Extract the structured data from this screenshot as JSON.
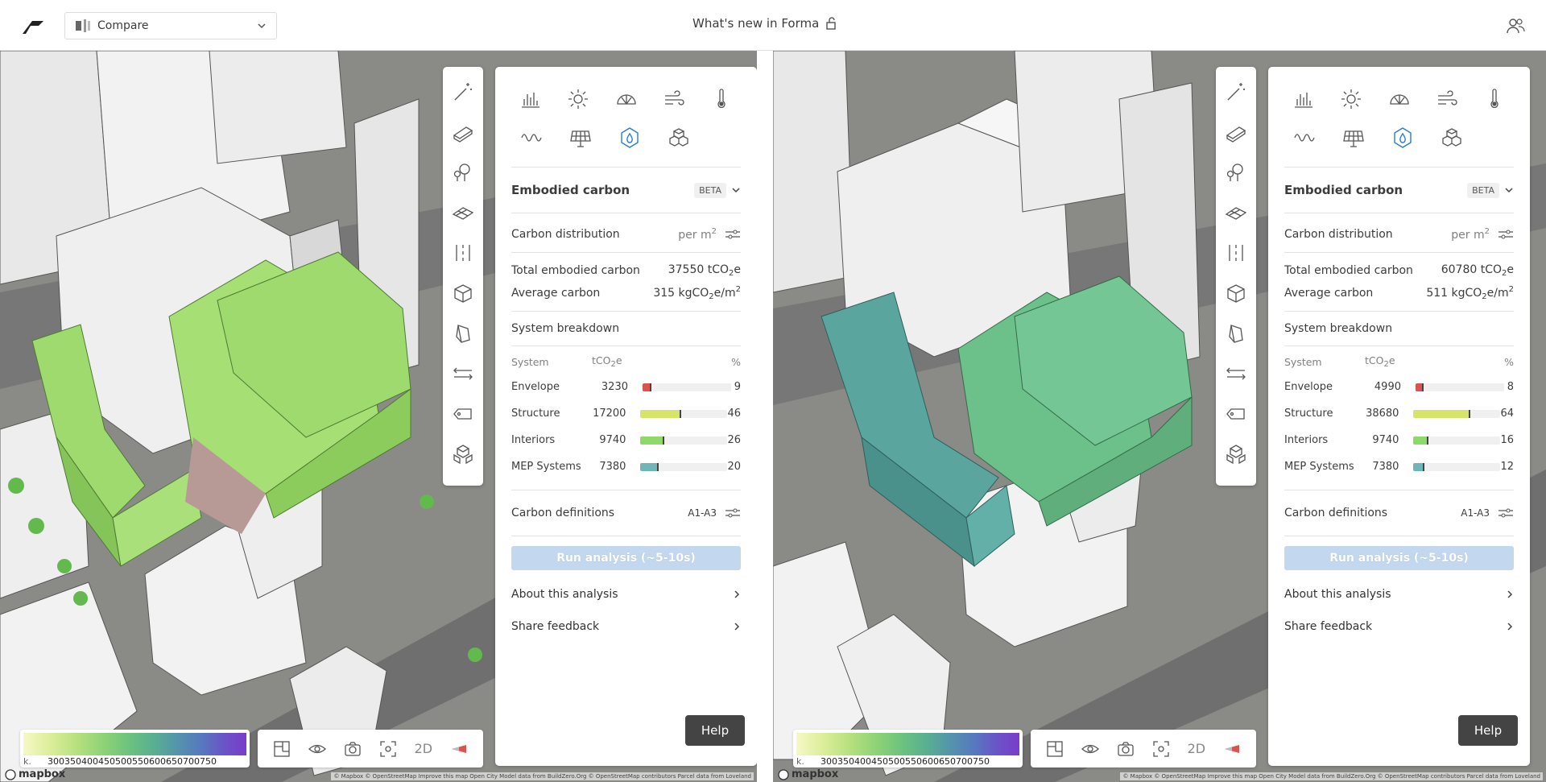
{
  "header": {
    "selector_label": "Compare",
    "title": "What's new in Forma"
  },
  "colors": {
    "left_buildings": "#9fda6e",
    "right_buildings_a": "#5aa69f",
    "right_buildings_b": "#6cc08a",
    "accent": "#2a7bd0",
    "run_button": "#c3d8ee"
  },
  "panes": [
    {
      "analysis_icons": [
        "bar-chart-icon",
        "sun-icon",
        "daylight-icon",
        "wind-icon",
        "thermometer-icon",
        "noise-icon",
        "solar-panel-icon",
        "carbon-drop-icon",
        "blocks-icon"
      ],
      "section_title": "Embodied carbon",
      "beta": "BETA",
      "carbon_distribution": "Carbon distribution",
      "per_m2": "per m",
      "total_label": "Total embodied carbon",
      "total_value": "37550 tCO",
      "total_unit": "e",
      "avg_label": "Average carbon",
      "avg_value": "315 kgCO",
      "avg_unit": "e/m",
      "system_breakdown": "System breakdown",
      "col_system": "System",
      "col_tco2e": "tCO",
      "col_pct": "%",
      "rows": [
        {
          "name": "Envelope",
          "value": "3230",
          "pct": "9",
          "frac": 0.09,
          "color": "#d9534f"
        },
        {
          "name": "Structure",
          "value": "17200",
          "pct": "46",
          "frac": 0.46,
          "color": "#d7e46a"
        },
        {
          "name": "Interiors",
          "value": "9740",
          "pct": "26",
          "frac": 0.26,
          "color": "#8fd96a"
        },
        {
          "name": "MEP Systems",
          "value": "7380",
          "pct": "20",
          "frac": 0.2,
          "color": "#6fb6b9"
        }
      ],
      "carbon_definitions": "Carbon definitions",
      "definitions_value": "A1-A3",
      "run_label": "Run analysis (~5-10s)",
      "about_label": "About this analysis",
      "feedback_label": "Share feedback",
      "help_label": "Help",
      "legend_ticks": [
        "k.",
        "300",
        "350",
        "400",
        "450",
        "500",
        "550",
        "600",
        "650",
        "700",
        "750"
      ],
      "view_2d": "2D"
    },
    {
      "analysis_icons": [
        "bar-chart-icon",
        "sun-icon",
        "daylight-icon",
        "wind-icon",
        "thermometer-icon",
        "noise-icon",
        "solar-panel-icon",
        "carbon-drop-icon",
        "blocks-icon"
      ],
      "section_title": "Embodied carbon",
      "beta": "BETA",
      "carbon_distribution": "Carbon distribution",
      "per_m2": "per m",
      "total_label": "Total embodied carbon",
      "total_value": "60780 tCO",
      "total_unit": "e",
      "avg_label": "Average carbon",
      "avg_value": "511 kgCO",
      "avg_unit": "e/m",
      "system_breakdown": "System breakdown",
      "col_system": "System",
      "col_tco2e": "tCO",
      "col_pct": "%",
      "rows": [
        {
          "name": "Envelope",
          "value": "4990",
          "pct": "8",
          "frac": 0.08,
          "color": "#d9534f"
        },
        {
          "name": "Structure",
          "value": "38680",
          "pct": "64",
          "frac": 0.64,
          "color": "#d7e46a"
        },
        {
          "name": "Interiors",
          "value": "9740",
          "pct": "16",
          "frac": 0.16,
          "color": "#8fd96a"
        },
        {
          "name": "MEP Systems",
          "value": "7380",
          "pct": "12",
          "frac": 0.12,
          "color": "#6fb6b9"
        }
      ],
      "carbon_definitions": "Carbon definitions",
      "definitions_value": "A1-A3",
      "run_label": "Run analysis (~5-10s)",
      "about_label": "About this analysis",
      "feedback_label": "Share feedback",
      "help_label": "Help",
      "legend_ticks": [
        "k.",
        "300",
        "350",
        "400",
        "450",
        "500",
        "550",
        "600",
        "650",
        "700",
        "750"
      ],
      "view_2d": "2D"
    }
  ],
  "map": {
    "mapbox": "mapbox",
    "attribution": "© Mapbox © OpenStreetMap Improve this map Open City Model data from BuildZero.Org © OpenStreetMap contributors Parcel data from Loveland"
  },
  "tools": [
    "magic-wand-icon",
    "building-icon",
    "tree-icon",
    "ground-plane-icon",
    "road-icon",
    "volume-icon",
    "shape-icon",
    "measure-icon",
    "tag-icon",
    "layers-icon"
  ]
}
